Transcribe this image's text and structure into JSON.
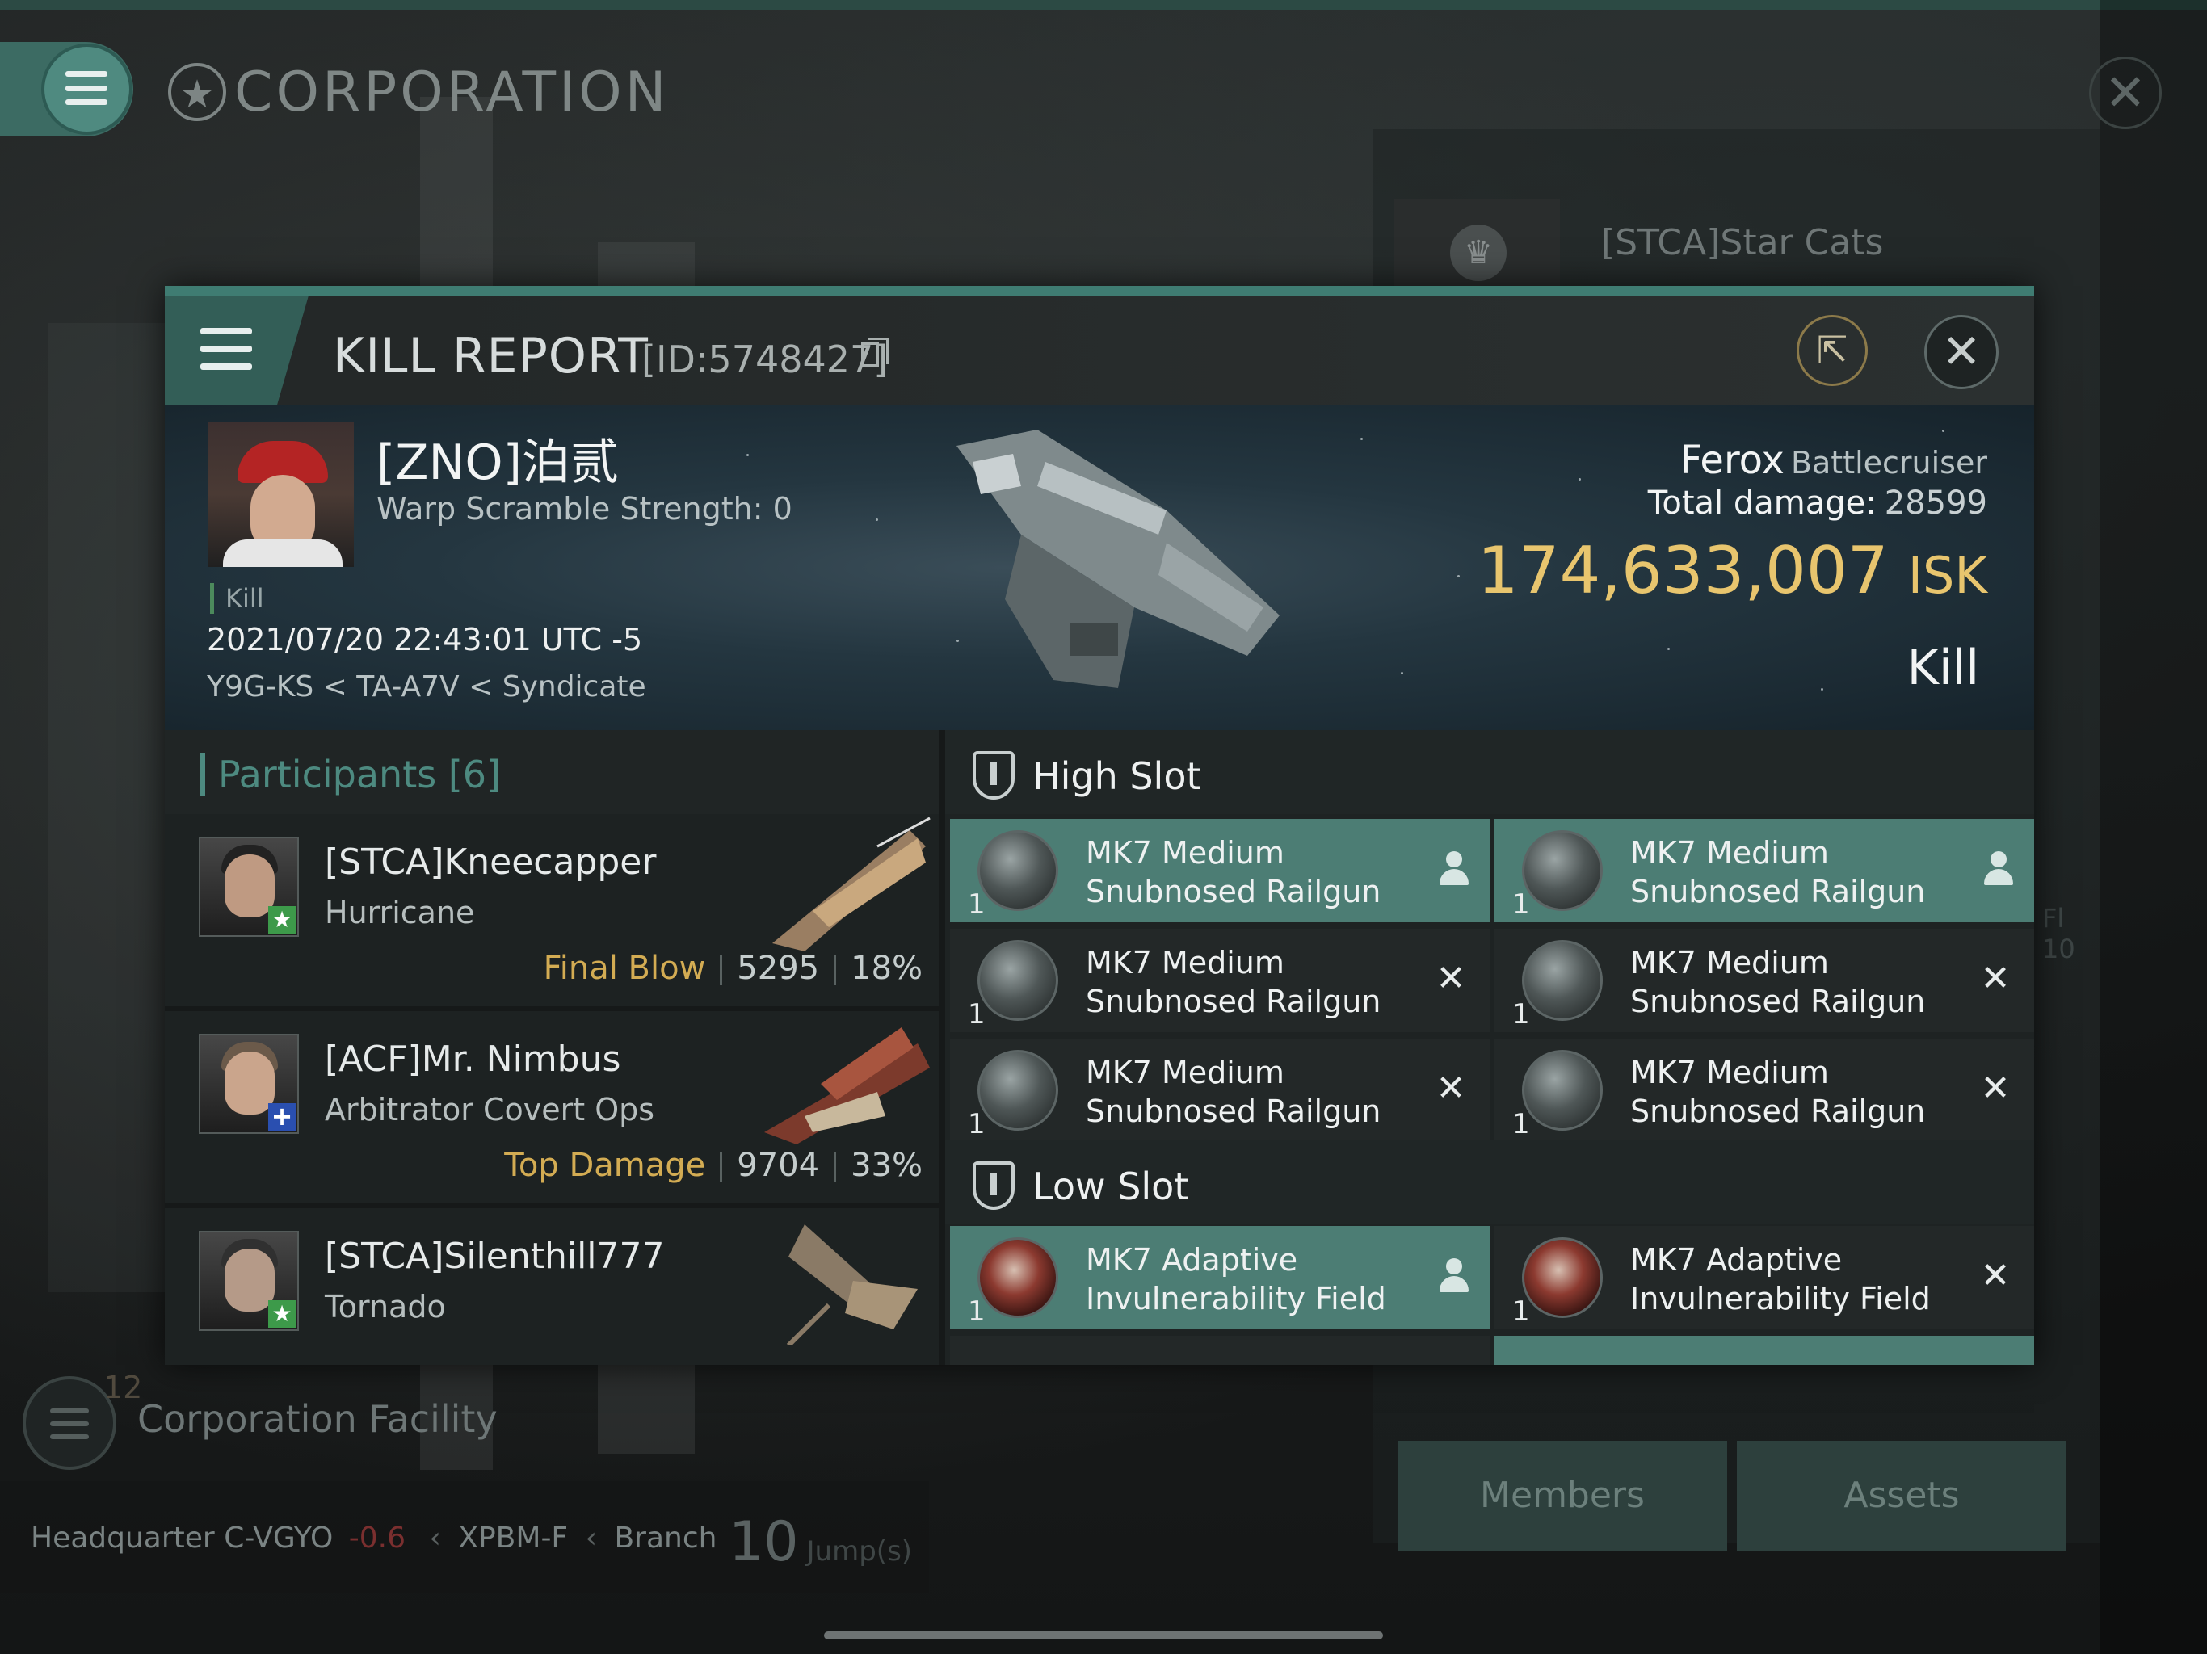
{
  "corp_header": {
    "title": "CORPORATION"
  },
  "bg_card": {
    "name": "[STCA]Star Cats"
  },
  "kill_report": {
    "title": "KILL REPORT",
    "id": "[ID:5748427]",
    "victim": {
      "name": "[ZNO]泊贰",
      "warp_scramble": "Warp Scramble Strength: 0",
      "tag": "Kill",
      "datetime": "2021/07/20 22:43:01 UTC -5",
      "location": "Y9G-KS < TA-A7V < Syndicate"
    },
    "ship": {
      "name": "Ferox",
      "class": "Battlecruiser",
      "damage_label": "Total damage:",
      "damage_value": "28599",
      "isk_value": "174,633,007",
      "isk_unit": "ISK",
      "result": "Kill"
    }
  },
  "participants": {
    "title": "Participants [6]",
    "rows": [
      {
        "name": "[STCA]Kneecapper",
        "ship": "Hurricane",
        "label": "Final Blow",
        "damage": "5295",
        "percent": "18%"
      },
      {
        "name": "[ACF]Mr. Nimbus",
        "ship": "Arbitrator Covert Ops",
        "label": "Top Damage",
        "damage": "9704",
        "percent": "33%"
      },
      {
        "name": "[STCA]Silenthill777",
        "ship": "Tornado"
      }
    ]
  },
  "slots": {
    "high_title": "High Slot",
    "low_title": "Low Slot",
    "high": [
      {
        "qty": "1",
        "name": "MK7 Medium Snubnosed Railgun",
        "state": "person"
      },
      {
        "qty": "1",
        "name": "MK7 Medium Snubnosed Railgun",
        "state": "person"
      },
      {
        "qty": "1",
        "name": "MK7 Medium Snubnosed Railgun",
        "state": "x"
      },
      {
        "qty": "1",
        "name": "MK7 Medium Snubnosed Railgun",
        "state": "x"
      },
      {
        "qty": "1",
        "name": "MK7 Medium Snubnosed Railgun",
        "state": "x"
      },
      {
        "qty": "1",
        "name": "MK7 Medium Snubnosed Railgun",
        "state": "x"
      }
    ],
    "low": [
      {
        "qty": "1",
        "name": "MK7 Adaptive Invulnerability Field",
        "state": "person"
      },
      {
        "qty": "1",
        "name": "MK7 Adaptive Invulnerability Field",
        "state": "x"
      }
    ]
  },
  "background": {
    "facility_count": "12",
    "facility_label": "Corporation Facility",
    "hq_label": "Headquarter",
    "hq_system": "C-VGYO",
    "hq_security": "-0.6",
    "hq_constellation": "XPBM-F",
    "hq_region": "Branch",
    "jumps_value": "10",
    "jumps_unit": "Jump(s)",
    "tab_members": "Members",
    "tab_assets": "Assets",
    "side_text_1": "Fl",
    "side_text_2": "10"
  },
  "colors": {
    "accent": "#4c7d74",
    "isk": "#e8c56e",
    "final_blow": "#d3ac53"
  }
}
